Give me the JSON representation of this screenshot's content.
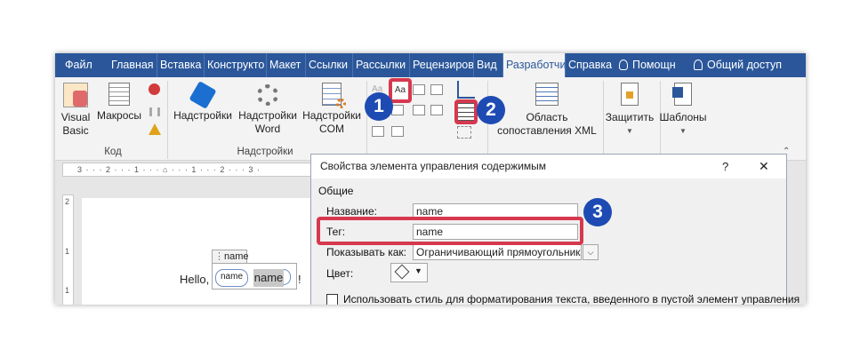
{
  "tabs": [
    "Файл",
    "Главная",
    "Вставка",
    "Конструкто",
    "Макет",
    "Ссылки",
    "Рассылки",
    "Рецензиров",
    "Вид",
    "Разработчи",
    "Справка",
    "Помощн",
    "Общий доступ"
  ],
  "ribbon": {
    "visual_basic": "Visual",
    "visual_basic_2": "Basic",
    "macros": "Макросы",
    "code_group": "Код",
    "addins": "Надстройки",
    "word_addins": "Надстройки",
    "word_addins_2": "Word",
    "com_addins": "Надстройки",
    "com_addins_2": "COM",
    "addins_group": "Надстройки",
    "mapping_pane": "Область",
    "mapping_pane_2": "сопоставления XML",
    "protect": "Защитить",
    "templates": "Шаблоны",
    "text_control_glyph": "Aa"
  },
  "ruler": {
    "h_marks": "3 · · · 2 · · · 1 · · · ⌂ · · · 1 · · · 2 · · · 3 ·",
    "v_marks": [
      "2",
      "1",
      "1"
    ]
  },
  "document": {
    "control_tag": "name",
    "prefix_text": "Hello,",
    "tag_chip": "name",
    "content": "name",
    "suffix": "!"
  },
  "dialog": {
    "title": "Свойства элемента управления содержимым",
    "help": "?",
    "close": "✕",
    "section": "Общие",
    "name_label": "Название:",
    "name_value": "name",
    "tag_label": "Тег:",
    "tag_value": "name",
    "show_as_label": "Показывать как:",
    "show_as_value": "Ограничивающий прямоугольник",
    "color_label": "Цвет:",
    "style_checkbox": "Использовать стиль для форматирования текста, введенного в пустой элемент управления"
  },
  "badges": [
    "1",
    "2",
    "3"
  ],
  "colors": {
    "accent": "#2b579a",
    "highlight": "#d6384f",
    "badge": "#1e4bb3"
  }
}
